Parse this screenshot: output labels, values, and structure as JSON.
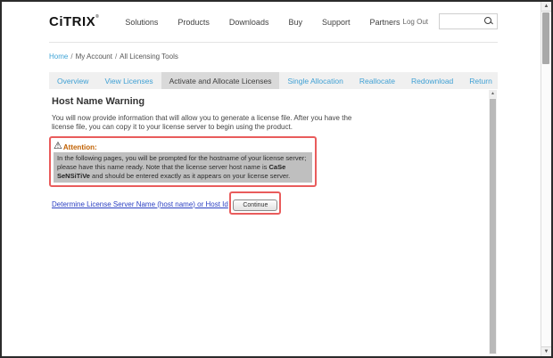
{
  "header": {
    "logo": "CiTRIX",
    "logo_mark": "®",
    "nav_items": [
      "Solutions",
      "Products",
      "Downloads",
      "Buy",
      "Support",
      "Partners"
    ],
    "logout_label": "Log Out",
    "search": {
      "value": ""
    }
  },
  "breadcrumb": {
    "separator": "/",
    "items": [
      "Home",
      "My Account",
      "All Licensing Tools"
    ]
  },
  "tabs": {
    "items": [
      {
        "label": "Overview",
        "active": false
      },
      {
        "label": "View Licenses",
        "active": false
      },
      {
        "label": "Activate and Allocate Licenses",
        "active": true
      },
      {
        "label": "Single Allocation",
        "active": false
      },
      {
        "label": "Reallocate",
        "active": false
      },
      {
        "label": "Redownload",
        "active": false
      },
      {
        "label": "Return",
        "active": false
      }
    ]
  },
  "main": {
    "title": "Host Name Warning",
    "intro": "You will now provide information that will allow you to generate a license file. After you have the license file, you can copy it to your license server to begin using the product.",
    "attention": {
      "icon": "⚠",
      "label": "Attention:",
      "text_before": "In the following pages, you will be prompted for the hostname of your license server; please have this name ready. Note that the license server host name is ",
      "text_emphasis": "CaSe SeNSiTiVe",
      "text_after": " and should be entered exactly as it appears on your license server."
    },
    "link_label": "Determine License Server Name (host name) or Host Id",
    "continue_label": "Continue"
  },
  "scrollbars": {
    "up_arrow": "▲",
    "down_arrow": "▼"
  },
  "colors": {
    "accent_blue": "#3fa4d6",
    "link_blue": "#2a3fc2",
    "attention_orange": "#c06000",
    "annotation_red": "#e95c5c",
    "active_tab_bg": "#d9d9d9",
    "tabbar_bg": "#f0f0f0",
    "attention_body_bg": "#bfbfbf"
  }
}
